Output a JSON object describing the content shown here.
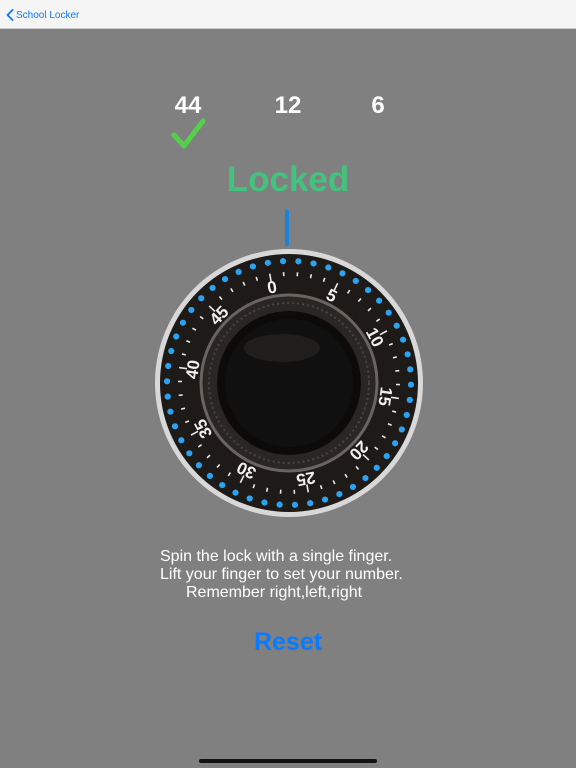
{
  "nav": {
    "back_label": "School Locker",
    "icon": "chevron-left-icon",
    "accent_color": "#0a7aff"
  },
  "combination": {
    "first": "44",
    "second": "12",
    "third": "6",
    "first_confirmed": true,
    "check_color": "#55d04a"
  },
  "status": {
    "text": "Locked",
    "color": "#43c27e"
  },
  "dial": {
    "labels": [
      "0",
      "5",
      "10",
      "15",
      "20",
      "25",
      "30",
      "35",
      "40",
      "45"
    ],
    "dot_color": "#2ba3f0",
    "pointer_color": "#1c82e0"
  },
  "instructions": {
    "line1": "Spin the lock with a single finger.",
    "line2": "Lift your finger to set your number.",
    "line3": "Remember right,left,right"
  },
  "reset": {
    "label": "Reset",
    "color": "#0a7aff"
  }
}
